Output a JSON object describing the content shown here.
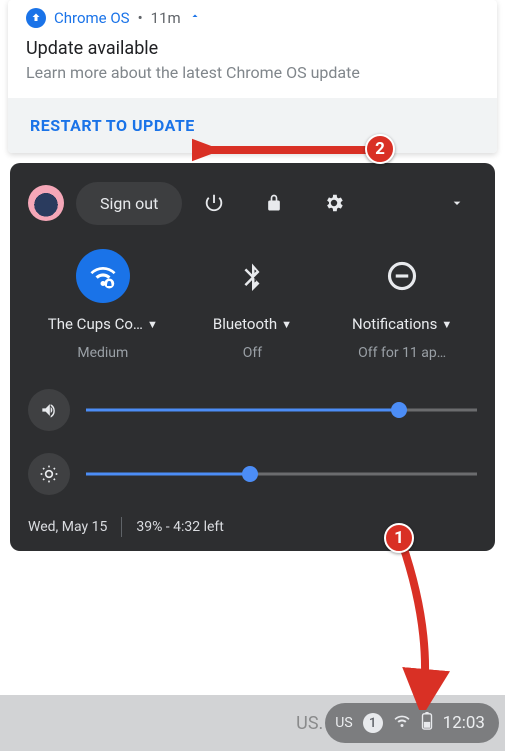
{
  "notification": {
    "source": "Chrome OS",
    "time": "11m",
    "title": "Update available",
    "description": "Learn more about the latest Chrome OS update",
    "action_label": "RESTART TO UPDATE"
  },
  "quick_settings": {
    "sign_out_label": "Sign out",
    "tiles": [
      {
        "label": "The Cups Co…",
        "sublabel": "Medium",
        "active": true,
        "icon": "wifi"
      },
      {
        "label": "Bluetooth",
        "sublabel": "Off",
        "active": false,
        "icon": "bluetooth"
      },
      {
        "label": "Notifications",
        "sublabel": "Off for 11 ap…",
        "active": false,
        "icon": "do-not-disturb"
      }
    ],
    "volume_percent": 80,
    "brightness_percent": 42,
    "date": "Wed, May 15",
    "battery_status": "39% - 4:32 left"
  },
  "taskbar": {
    "obscured_text": "US.",
    "language": "US",
    "notification_count": "1",
    "clock": "12:03"
  },
  "annotations": {
    "badge1": "1",
    "badge2": "2"
  },
  "colors": {
    "accent": "#1a73e8",
    "panel": "#2d2e30",
    "annotation": "#d93025"
  }
}
